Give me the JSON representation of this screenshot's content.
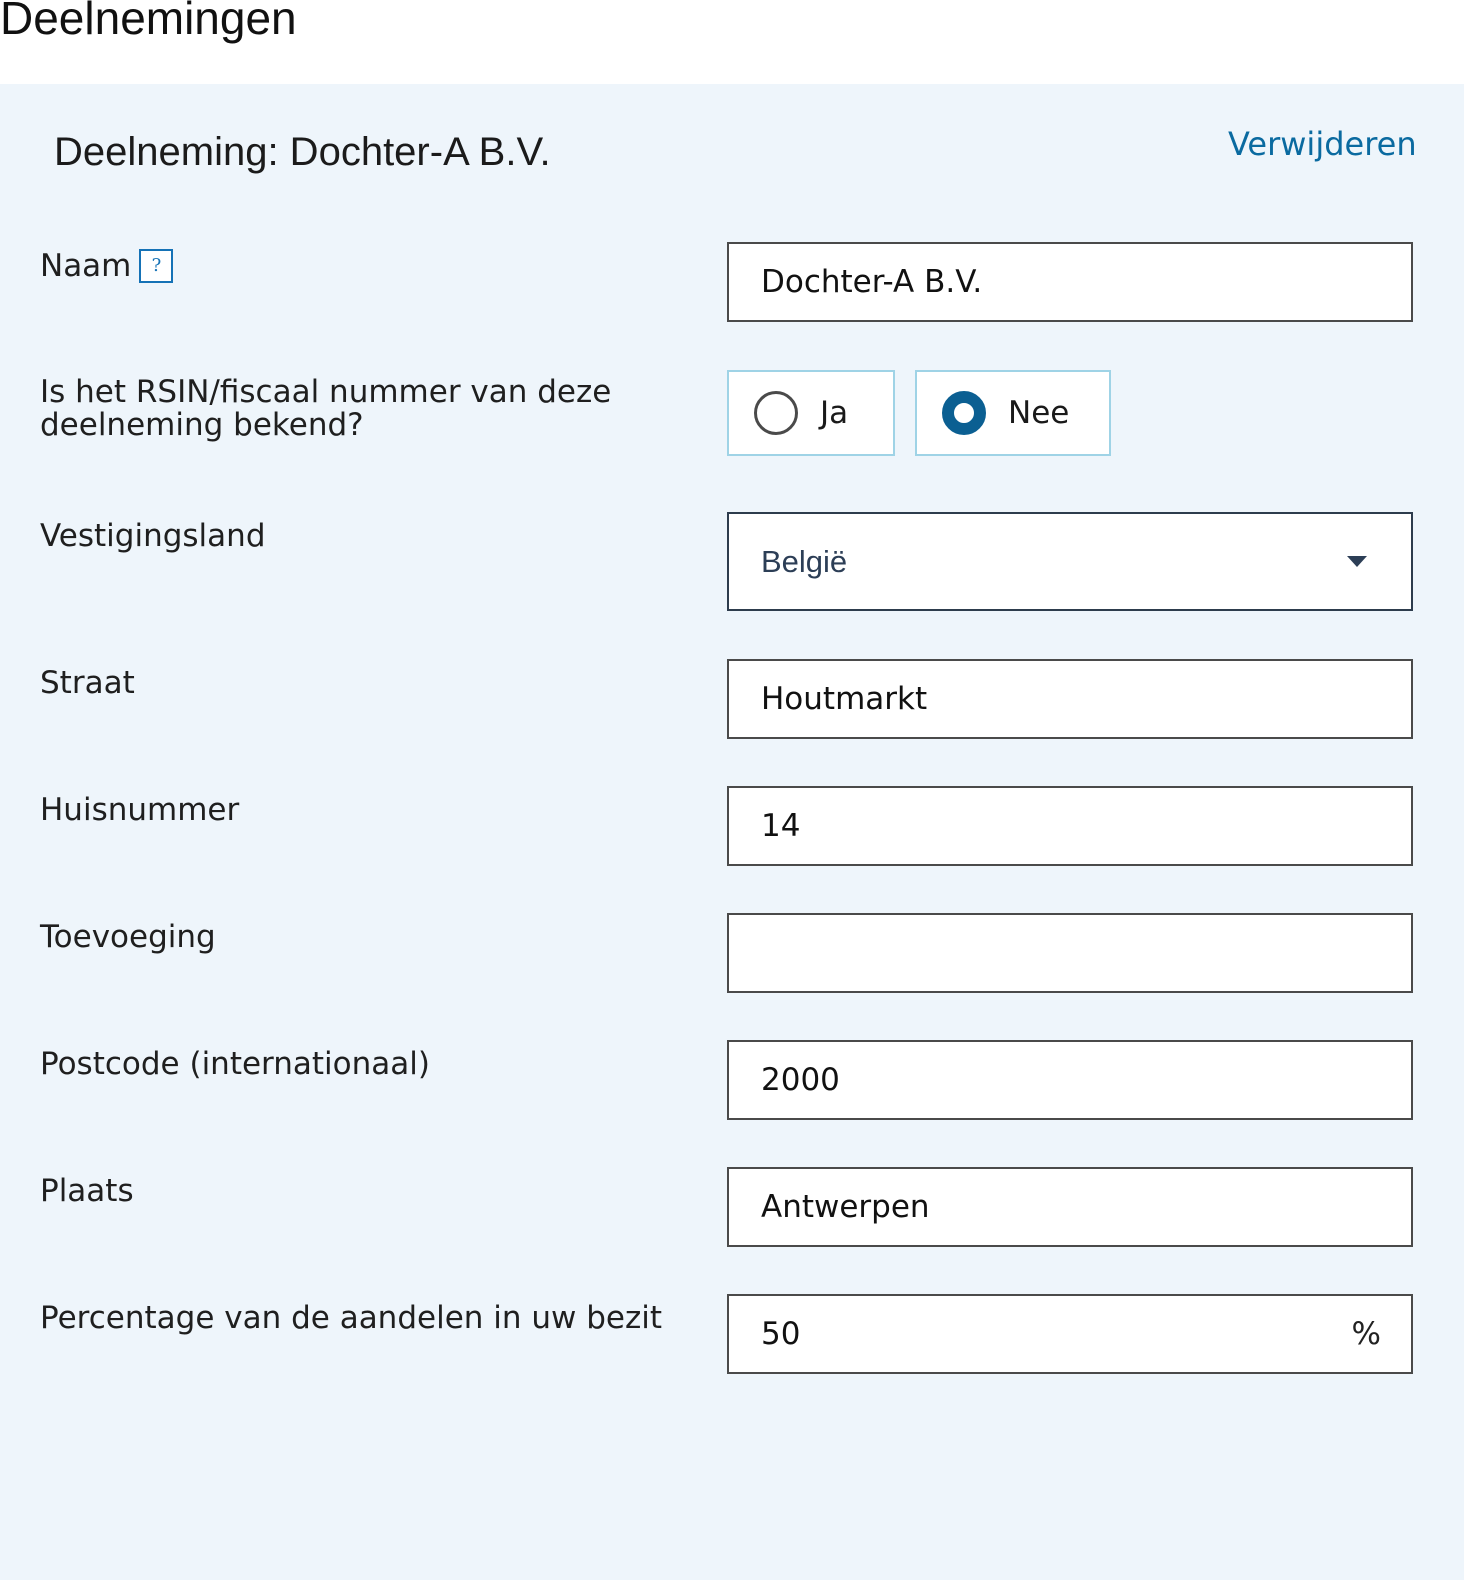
{
  "page": {
    "heading": "Deelnemingen"
  },
  "section": {
    "title": "Deelneming: Dochter-A B.V.",
    "delete_label": "Verwijderen"
  },
  "fields": {
    "naam": {
      "label": "Naam",
      "help_icon": "?",
      "value": "Dochter-A B.V."
    },
    "rsin": {
      "label_line1": "Is het RSIN/fiscaal nummer van deze",
      "label_line2": "deelneming bekend?",
      "options": [
        {
          "label": "Ja",
          "selected": false
        },
        {
          "label": "Nee",
          "selected": true
        }
      ]
    },
    "vestigingsland": {
      "label": "Vestigingsland",
      "value": "België"
    },
    "straat": {
      "label": "Straat",
      "value": "Houtmarkt"
    },
    "huisnummer": {
      "label": "Huisnummer",
      "value": "14"
    },
    "toevoeging": {
      "label": "Toevoeging",
      "value": ""
    },
    "postcode": {
      "label": "Postcode (internationaal)",
      "value": "2000"
    },
    "plaats": {
      "label": "Plaats",
      "value": "Antwerpen"
    },
    "percentage": {
      "label": "Percentage van de aandelen in uw bezit",
      "value": "50",
      "suffix": "%"
    }
  },
  "colors": {
    "panel_background": "#eef5fb",
    "link": "#0a6aa0",
    "radio_selected": "#0b5f92",
    "radio_border": "#9fd3e6"
  },
  "icons": {
    "help": "help-icon",
    "dropdown": "chevron-down-icon"
  }
}
